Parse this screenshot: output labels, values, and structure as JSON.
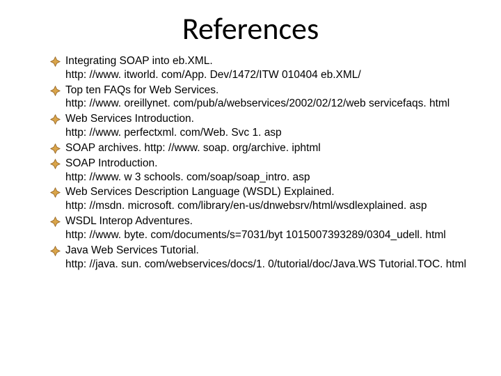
{
  "title": "References",
  "references": [
    {
      "title": "Integrating SOAP into eb.XML.",
      "url": "http: //www. itworld. com/App. Dev/1472/ITW 010404 eb.XML/"
    },
    {
      "title": "Top ten FAQs for Web Services.",
      "url": "http: //www. oreillynet. com/pub/a/webservices/2002/02/12/web servicefaqs. html"
    },
    {
      "title": "Web Services Introduction.",
      "url": "http: //www. perfectxml. com/Web. Svc 1. asp"
    },
    {
      "title": "SOAP archives. http: //www. soap. org/archive. iphtml",
      "url": ""
    },
    {
      "title": "SOAP Introduction.",
      "url": "http: //www. w 3 schools. com/soap/soap_intro. asp"
    },
    {
      "title": "Web Services Description Language (WSDL) Explained.",
      "url": "http: //msdn. microsoft. com/library/en-us/dnwebsrv/html/wsdlexplained. asp"
    },
    {
      "title": "WSDL Interop Adventures.",
      "url": "http: //www. byte. com/documents/s=7031/byt 1015007393289/0304_udell. html"
    },
    {
      "title": "Java Web Services Tutorial.",
      "url": "http: //java. sun. com/webservices/docs/1. 0/tutorial/doc/Java.WS Tutorial.TOC. html"
    }
  ]
}
